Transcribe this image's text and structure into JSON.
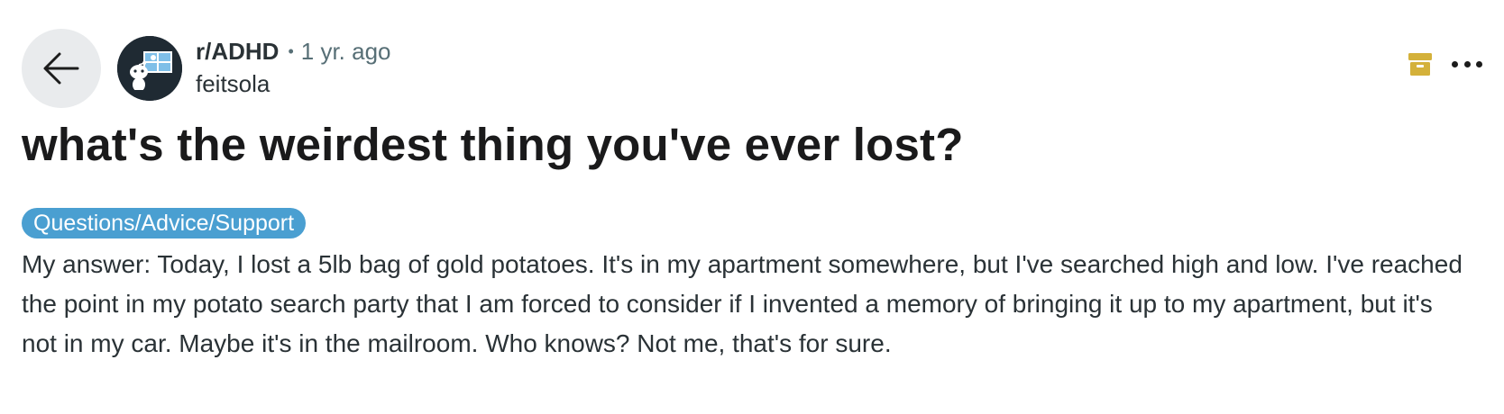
{
  "post": {
    "subreddit": "r/ADHD",
    "separator": "•",
    "age": "1 yr. ago",
    "author": "feitsola",
    "title": "what's the weirdest thing you've ever lost?",
    "flair": "Questions/Advice/Support",
    "body": "My answer: Today, I lost a 5lb bag of gold potatoes. It's in my apartment somewhere, but I've searched high and low. I've reached the point in my potato search party that I am forced to consider if I invented a memory of bringing it up to my apartment, but it's not in my car. Maybe it's in the mailroom. Who knows? Not me, that's for sure."
  },
  "icons": {
    "back": "arrow-left-icon",
    "avatar": "subreddit-avatar",
    "archive": "archive-icon",
    "more": "more-options-icon"
  },
  "colors": {
    "flair_bg": "#4a9fd1",
    "archive": "#d4b13a",
    "back_bg": "#e9ebed"
  }
}
